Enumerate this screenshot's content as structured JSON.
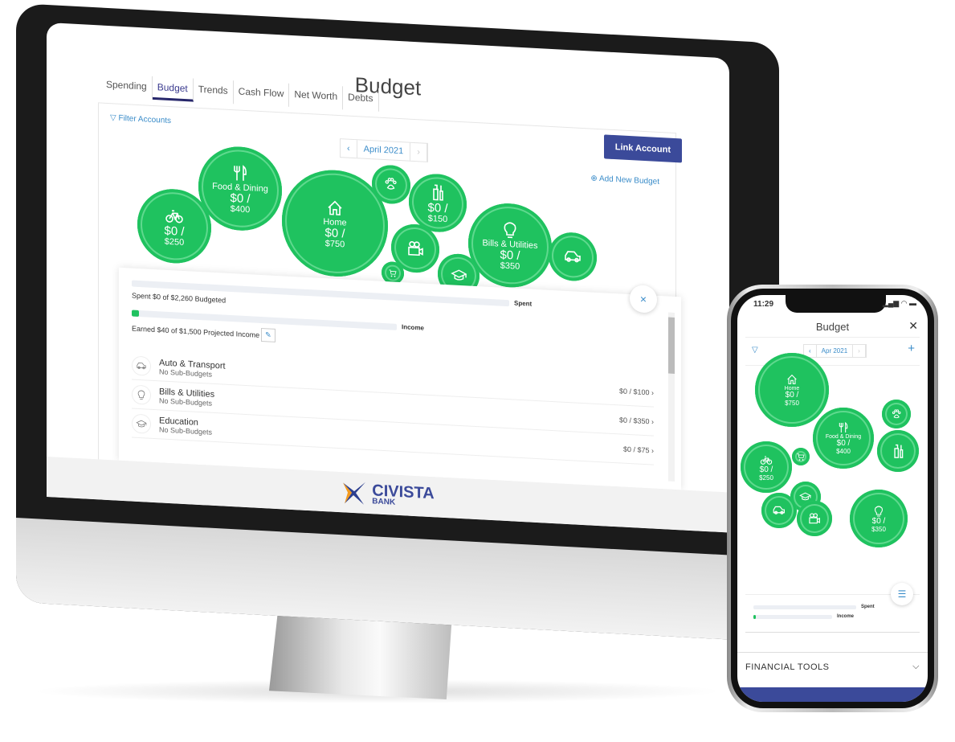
{
  "colors": {
    "accent": "#1fc25f",
    "brand": "#3b4a9a",
    "link": "#3a8cc9"
  },
  "desktop": {
    "title": "Budget",
    "tabs": [
      "Spending",
      "Budget",
      "Trends",
      "Cash Flow",
      "Net Worth",
      "Debts"
    ],
    "active_tab": "Budget",
    "filter_label": "Filter Accounts",
    "link_account": "Link Account",
    "month": "April 2021",
    "add_budget": "Add New Budget",
    "bubbles": [
      {
        "icon": "bike",
        "label": "",
        "spent": "$0 /",
        "total": "$250"
      },
      {
        "icon": "fork-knife",
        "label": "Food & Dining",
        "spent": "$0 /",
        "total": "$400"
      },
      {
        "icon": "home",
        "label": "Home",
        "spent": "$0 /",
        "total": "$750"
      },
      {
        "icon": "paw",
        "label": "",
        "spent": "",
        "total": ""
      },
      {
        "icon": "toiletries",
        "label": "",
        "spent": "$0 /",
        "total": "$150"
      },
      {
        "icon": "camera",
        "label": "",
        "spent": "",
        "total": ""
      },
      {
        "icon": "cart",
        "label": "",
        "spent": "",
        "total": ""
      },
      {
        "icon": "graduation",
        "label": "",
        "spent": "",
        "total": ""
      },
      {
        "icon": "bulb",
        "label": "Bills & Utilities",
        "spent": "$0 /",
        "total": "$350"
      },
      {
        "icon": "car",
        "label": "",
        "spent": "",
        "total": ""
      }
    ],
    "summary": {
      "spent_text": "Spent $0 of $2,260 Budgeted",
      "spent_label": "Spent",
      "spent_fraction": 0,
      "income_text": "Earned $40 of $1,500 Projected Income",
      "income_label": "Income",
      "income_fraction": 0.027,
      "close": "×"
    },
    "rows": [
      {
        "icon": "car",
        "name": "Auto & Transport",
        "sub": "No Sub-Budgets",
        "value": "$0 / $100 ›"
      },
      {
        "icon": "bulb",
        "name": "Bills & Utilities",
        "sub": "No Sub-Budgets",
        "value": "$0 / $350 ›"
      },
      {
        "icon": "graduation",
        "name": "Education",
        "sub": "No Sub-Budgets",
        "value": "$0 / $75 ›"
      }
    ],
    "logo": {
      "name": "CIVISTA",
      "sub": "BANK"
    }
  },
  "phone": {
    "time": "11:29",
    "status": "▂▄▆ ◠ ▬",
    "title": "Budget",
    "close": "✕",
    "month": "Apr 2021",
    "plus": "+",
    "bubbles": [
      {
        "icon": "home",
        "label": "Home",
        "spent": "$0 /",
        "total": "$750"
      },
      {
        "icon": "paw",
        "label": "",
        "spent": "",
        "total": ""
      },
      {
        "icon": "bike",
        "label": "",
        "spent": "$0 /",
        "total": "$250"
      },
      {
        "icon": "cart",
        "label": "",
        "spent": "",
        "total": ""
      },
      {
        "icon": "fork-knife",
        "label": "Food & Dining",
        "spent": "$0 /",
        "total": "$400"
      },
      {
        "icon": "toiletries",
        "label": "",
        "spent": "",
        "total": ""
      },
      {
        "icon": "graduation",
        "label": "",
        "spent": "",
        "total": ""
      },
      {
        "icon": "car",
        "label": "",
        "spent": "",
        "total": ""
      },
      {
        "icon": "camera",
        "label": "",
        "spent": "",
        "total": ""
      },
      {
        "icon": "bulb",
        "label": "",
        "spent": "$0 /",
        "total": "$350"
      }
    ],
    "spent_label": "Spent",
    "income_label": "Income",
    "financial_tools": "FINANCIAL TOOLS"
  }
}
